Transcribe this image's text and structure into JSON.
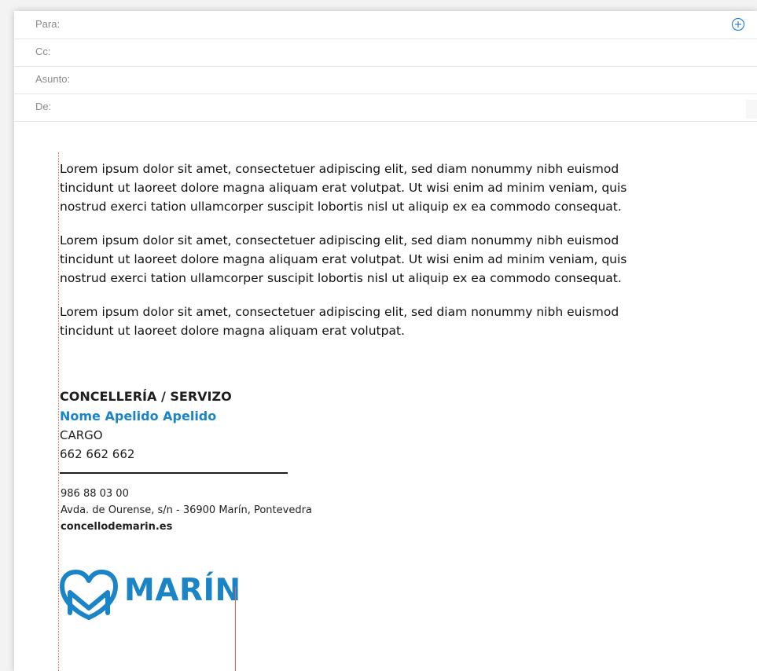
{
  "header": {
    "to_label": "Para:",
    "cc_label": "Cc:",
    "subject_label": "Asunto:",
    "from_label": "De:"
  },
  "body": {
    "paragraphs": [
      "Lorem ipsum dolor sit amet, consectetuer adipiscing elit, sed diam nonummy nibh euismod\ntincidunt ut laoreet dolore magna aliquam erat volutpat. Ut wisi enim ad minim veniam, quis\nnostrud exerci tation ullamcorper suscipit lobortis nisl ut aliquip ex ea commodo consequat.",
      "Lorem ipsum dolor sit amet, consectetuer adipiscing elit, sed diam nonummy nibh euismod\ntincidunt ut laoreet dolore magna aliquam erat volutpat. Ut wisi enim ad minim veniam, quis\nnostrud exerci tation ullamcorper suscipit lobortis nisl ut aliquip ex ea commodo consequat.",
      "Lorem ipsum dolor sit amet, consectetuer adipiscing elit, sed diam nonummy nibh euismod\ntincidunt ut laoreet dolore magna aliquam erat volutpat."
    ]
  },
  "signature": {
    "department": "CONCELLERÍA / SERVIZO",
    "name": "Nome Apelido Apelido",
    "role": "CARGO",
    "mobile": "662 662 662",
    "phone": "986 88 03 00",
    "address": "Avda. de Ourense, s/n - 36900 Marín, Pontevedra",
    "website": "concellodemarin.es",
    "logo_text": "MARÍN"
  },
  "colors": {
    "brand_blue": "#1b84c7",
    "guide_red": "#e0644f",
    "label_gray": "#8a8a8a"
  },
  "icons": {
    "add_recipient": "plus-circle-icon",
    "logo": "marin-heart-m-logo"
  }
}
